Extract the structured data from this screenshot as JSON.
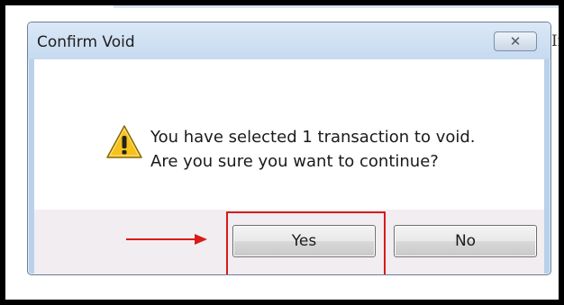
{
  "background": {
    "text": "Ir"
  },
  "dialog": {
    "title": "Confirm Void",
    "close_icon": "close-icon",
    "warning_icon": "warning-icon",
    "message_line_1": "You have selected 1 transaction to void.",
    "message_line_2": "Are you sure you want to continue?",
    "buttons": {
      "yes_label": "Yes",
      "no_label": "No"
    }
  },
  "annotation": {
    "color": "#d71b1b",
    "arrow_icon": "arrow-right-icon"
  }
}
